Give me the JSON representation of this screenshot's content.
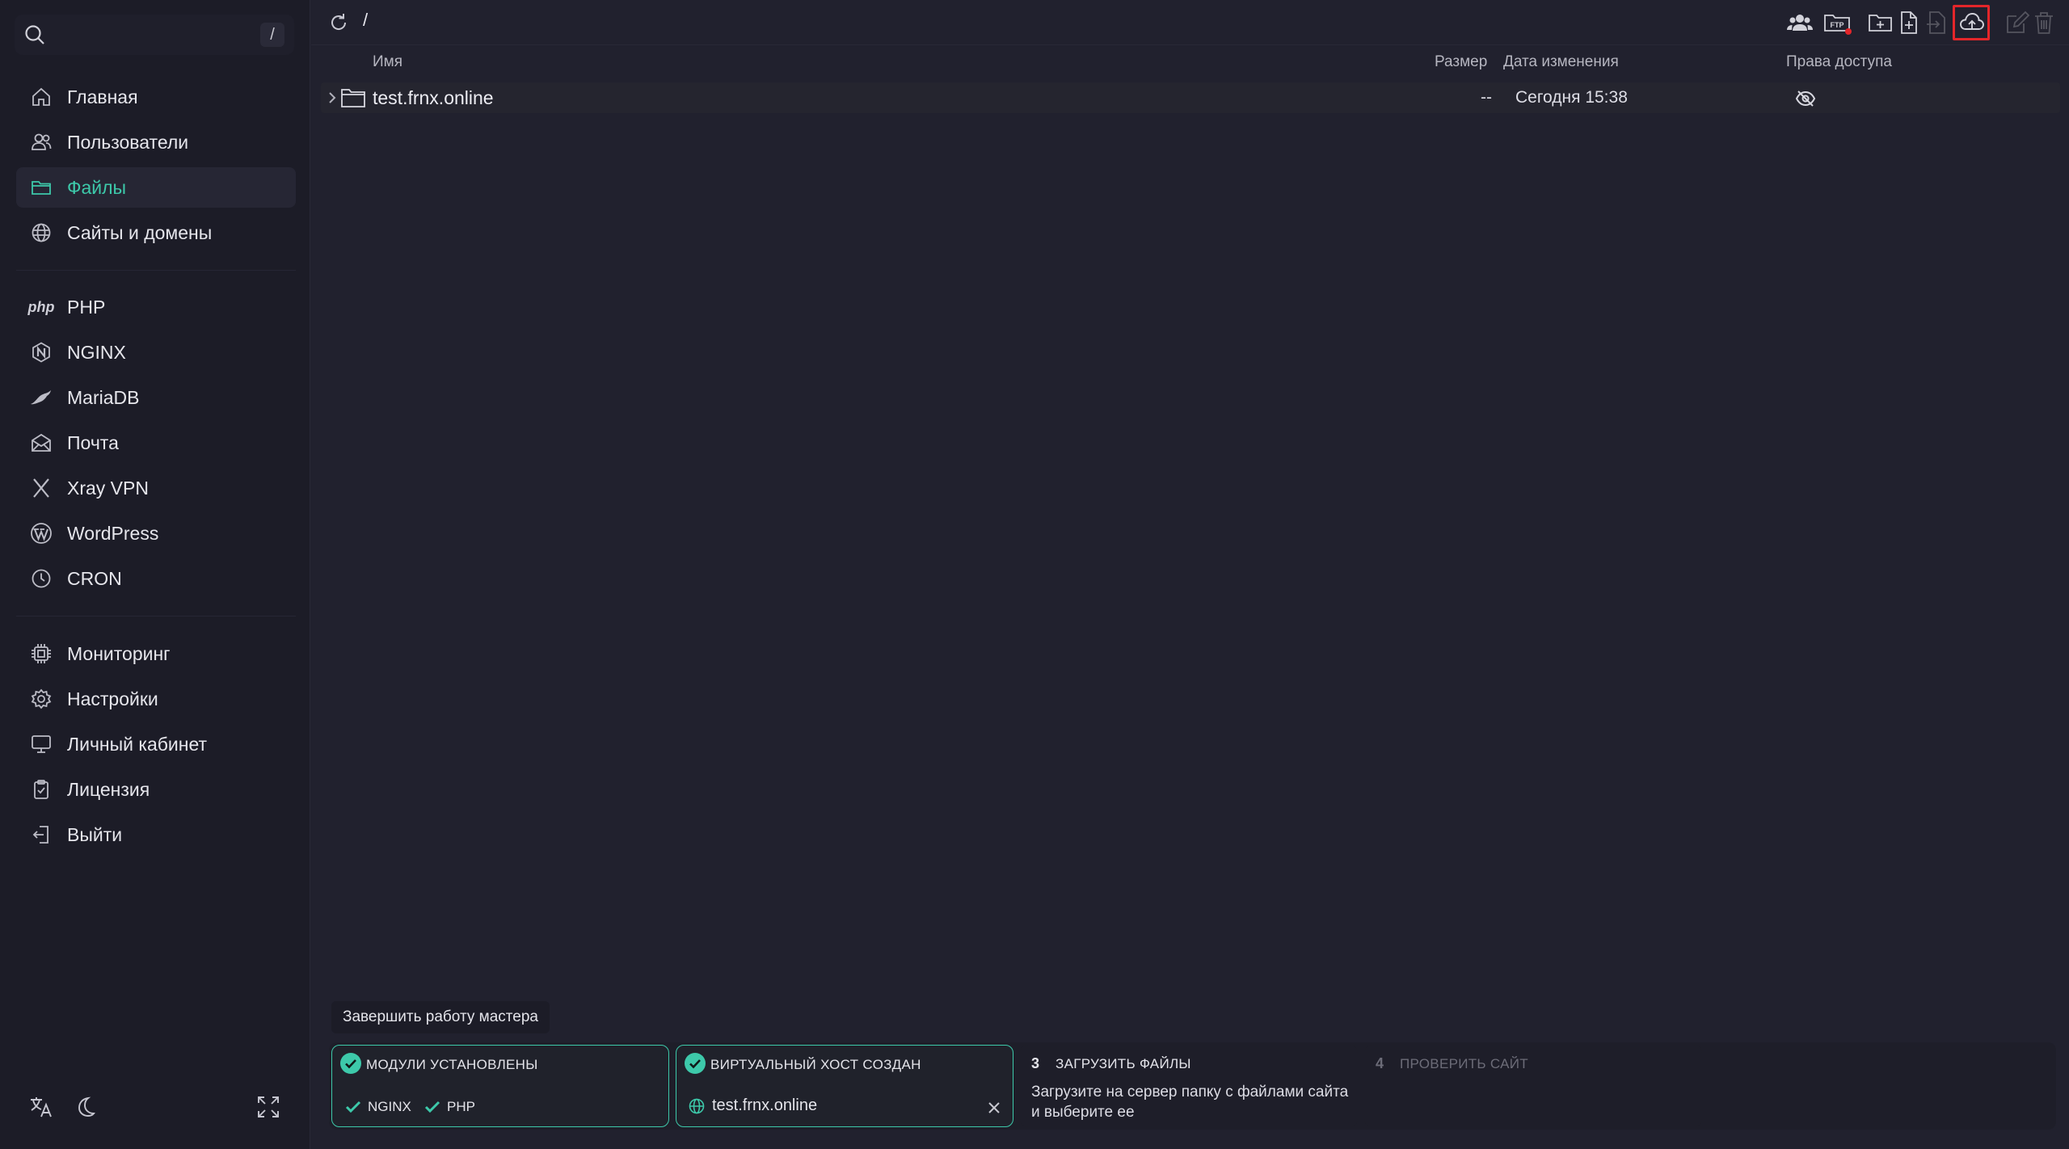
{
  "search": {
    "shortcut": "/"
  },
  "sidebar": {
    "primary": [
      {
        "label": "Главная",
        "icon": "home-icon"
      },
      {
        "label": "Пользователи",
        "icon": "users-icon"
      },
      {
        "label": "Файлы",
        "icon": "folder-icon",
        "active": true
      },
      {
        "label": "Сайты и домены",
        "icon": "globe-icon"
      }
    ],
    "services": [
      {
        "label": "PHP",
        "icon": "php-icon",
        "icon_text": "php"
      },
      {
        "label": "NGINX",
        "icon": "nginx-icon"
      },
      {
        "label": "MariaDB",
        "icon": "mariadb-icon"
      },
      {
        "label": "Почта",
        "icon": "mail-icon"
      },
      {
        "label": "Xray VPN",
        "icon": "xray-icon"
      },
      {
        "label": "WordPress",
        "icon": "wordpress-icon"
      },
      {
        "label": "CRON",
        "icon": "clock-icon"
      }
    ],
    "system": [
      {
        "label": "Мониторинг",
        "icon": "chip-icon"
      },
      {
        "label": "Настройки",
        "icon": "settings-icon"
      },
      {
        "label": "Личный кабинет",
        "icon": "monitor-icon"
      },
      {
        "label": "Лицензия",
        "icon": "license-icon"
      },
      {
        "label": "Выйти",
        "icon": "logout-icon"
      }
    ]
  },
  "toolbar": {
    "path": "/",
    "ftp_badge": "FTP",
    "icons": [
      "users-group-icon",
      "ftp-folder-icon",
      "new-folder-icon",
      "new-file-icon",
      "move-icon",
      "upload-cloud-icon",
      "edit-icon",
      "trash-icon"
    ]
  },
  "table": {
    "columns": {
      "name": "Имя",
      "size": "Размер",
      "modified": "Дата изменения",
      "permissions": "Права доступа"
    },
    "rows": [
      {
        "name": "test.frnx.online",
        "size": "--",
        "modified": "Сегодня 15:38",
        "permissions_icon": "eye-off-icon"
      }
    ]
  },
  "wizard": {
    "finish_label": "Завершить работу мастера",
    "steps": [
      {
        "status": "done",
        "title": "МОДУЛИ УСТАНОВЛЕНЫ",
        "modules": [
          "NGINX",
          "PHP"
        ]
      },
      {
        "status": "done",
        "title": "ВИРТУАЛЬНЫЙ ХОСТ СОЗДАН",
        "host": "test.frnx.online"
      },
      {
        "status": "current",
        "number": "3",
        "title": "ЗАГРУЗИТЬ ФАЙЛЫ",
        "description": "Загрузите на сервер папку с файлами сайта и выберите ее"
      },
      {
        "status": "pending",
        "number": "4",
        "title": "ПРОВЕРИТЬ САЙТ"
      }
    ]
  },
  "colors": {
    "accent": "#3dc9aa",
    "background": "#21212e",
    "sidebar": "#1c1c27",
    "highlight": "#e4262a",
    "badge": "#e4262a"
  }
}
